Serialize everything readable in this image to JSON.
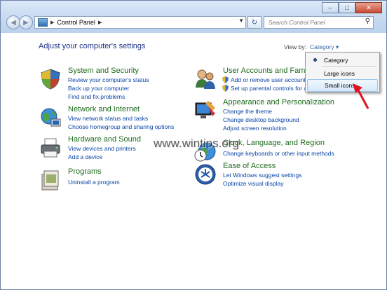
{
  "window": {
    "address": "Control Panel",
    "search_placeholder": "Search Control Panel",
    "minimize": "–",
    "maximize": "□",
    "close": "✕"
  },
  "page": {
    "heading": "Adjust your computer's settings",
    "view_by_label": "View by:",
    "view_by_value": "Category ▾"
  },
  "menu": {
    "items": [
      "Category",
      "Large icons",
      "Small icons"
    ],
    "selected": "Category",
    "hovered": "Small icons"
  },
  "categories": [
    {
      "title": "System and Security",
      "icon": "shield-icon",
      "links": [
        "Review your computer's status",
        "Back up your computer",
        "Find and fix problems"
      ]
    },
    {
      "title": "Network and Internet",
      "icon": "network-globe-icon",
      "links": [
        "View network status and tasks",
        "Choose homegroup and sharing options"
      ]
    },
    {
      "title": "Hardware and Sound",
      "icon": "printer-icon",
      "links": [
        "View devices and printers",
        "Add a device"
      ]
    },
    {
      "title": "Programs",
      "icon": "programs-icon",
      "links": [
        "Uninstall a program"
      ]
    },
    {
      "title": "User Accounts and Family",
      "icon": "users-icon",
      "links": [
        "Add or remove user accounts",
        "Set up parental controls for any"
      ]
    },
    {
      "title": "Appearance and Personalization",
      "icon": "monitor-paint-icon",
      "links": [
        "Change the theme",
        "Change desktop background",
        "Adjust screen resolution"
      ]
    },
    {
      "title": "Clock, Language, and Region",
      "icon": "clock-globe-icon",
      "links": [
        "Change keyboards or other input methods"
      ]
    },
    {
      "title": "Ease of Access",
      "icon": "ease-of-access-icon",
      "links": [
        "Let Windows suggest settings",
        "Optimize visual display"
      ]
    }
  ],
  "watermark": "www.wintips.org",
  "colors": {
    "title_green": "#1e6b1e",
    "link_blue": "#0a45a8",
    "heading_blue": "#1e3287",
    "arrow_red": "#e0141e"
  }
}
